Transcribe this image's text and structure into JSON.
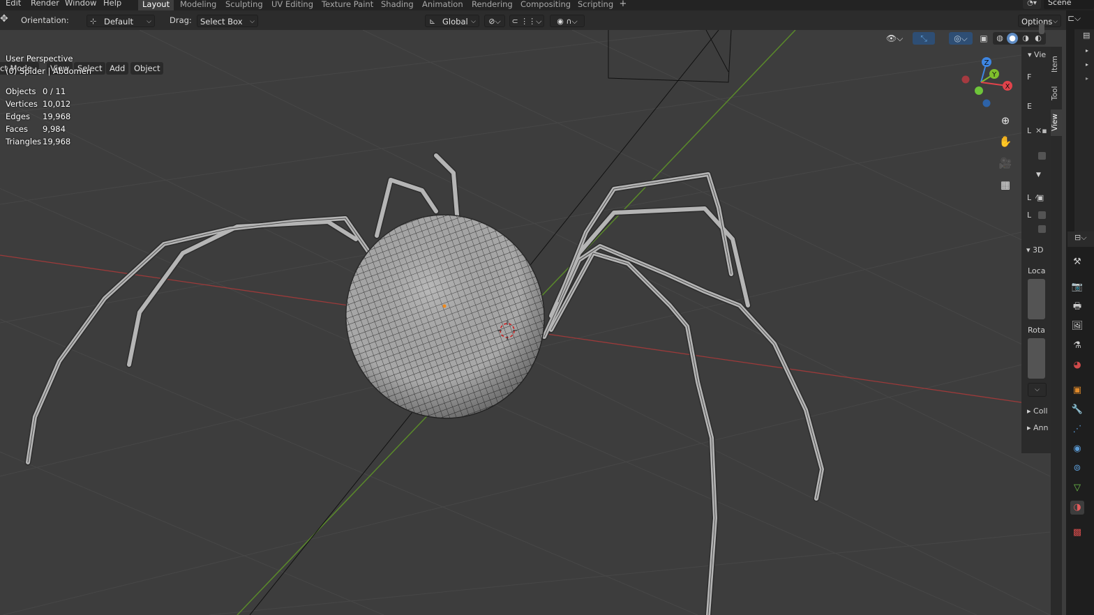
{
  "menu": [
    "Edit",
    "Render",
    "Window",
    "Help"
  ],
  "workspace_tabs": [
    {
      "label": "Layout",
      "active": true
    },
    {
      "label": "Modeling",
      "active": false
    },
    {
      "label": "Sculpting",
      "active": false
    },
    {
      "label": "UV Editing",
      "active": false
    },
    {
      "label": "Texture Paint",
      "active": false
    },
    {
      "label": "Shading",
      "active": false
    },
    {
      "label": "Animation",
      "active": false
    },
    {
      "label": "Rendering",
      "active": false
    },
    {
      "label": "Compositing",
      "active": false
    },
    {
      "label": "Scripting",
      "active": false
    }
  ],
  "scene_name": "Scene",
  "tool_header": {
    "orientation_label": "Orientation:",
    "orientation_value": "Default",
    "drag_label": "Drag:",
    "drag_value": "Select Box",
    "transform_orientation": "Global",
    "options_label": "Options"
  },
  "view_header": {
    "mode": "ct Mode",
    "view": "View",
    "select": "Select",
    "add": "Add",
    "object": "Object"
  },
  "overlay": {
    "perspective": "User Perspective",
    "context": "(0) Spider | Abdomen",
    "stats": [
      {
        "label": "Objects",
        "value": "0 / 11"
      },
      {
        "label": "Vertices",
        "value": "10,012"
      },
      {
        "label": "Edges",
        "value": "19,968"
      },
      {
        "label": "Faces",
        "value": "9,984"
      },
      {
        "label": "Triangles",
        "value": "19,968"
      }
    ]
  },
  "gizmo_axes": {
    "x": "X",
    "y": "Y",
    "z": "Z",
    "x_color": "#e2434b",
    "y_color": "#7fbf2c",
    "z_color": "#3e86e2"
  },
  "n_panel": {
    "tabs": [
      "Item",
      "Tool",
      "View"
    ],
    "active_tab": "View",
    "view_header": "Vie",
    "rows": [
      "F",
      "E",
      "L",
      "L",
      "L"
    ],
    "section_3d": "3D",
    "location_label": "Loca",
    "rotation_label": "Rota",
    "collapsed": [
      "Coll",
      "Ann"
    ]
  },
  "colors": {
    "viewport_bg": "#3d3d3d",
    "grid_line": "#474747",
    "x_axis": "#9c3a3a",
    "y_axis": "#5a8a2a",
    "mesh_fill": "#a9a9a9",
    "mesh_wire": "#2a2a2a"
  },
  "property_icons": [
    "tool-icon",
    "render-icon",
    "output-icon",
    "view-layer-icon",
    "scene-icon",
    "world-icon",
    "object-icon",
    "modifier-icon",
    "particles-icon",
    "physics-icon",
    "constraints-icon",
    "data-icon",
    "material-icon",
    "texture-icon"
  ]
}
